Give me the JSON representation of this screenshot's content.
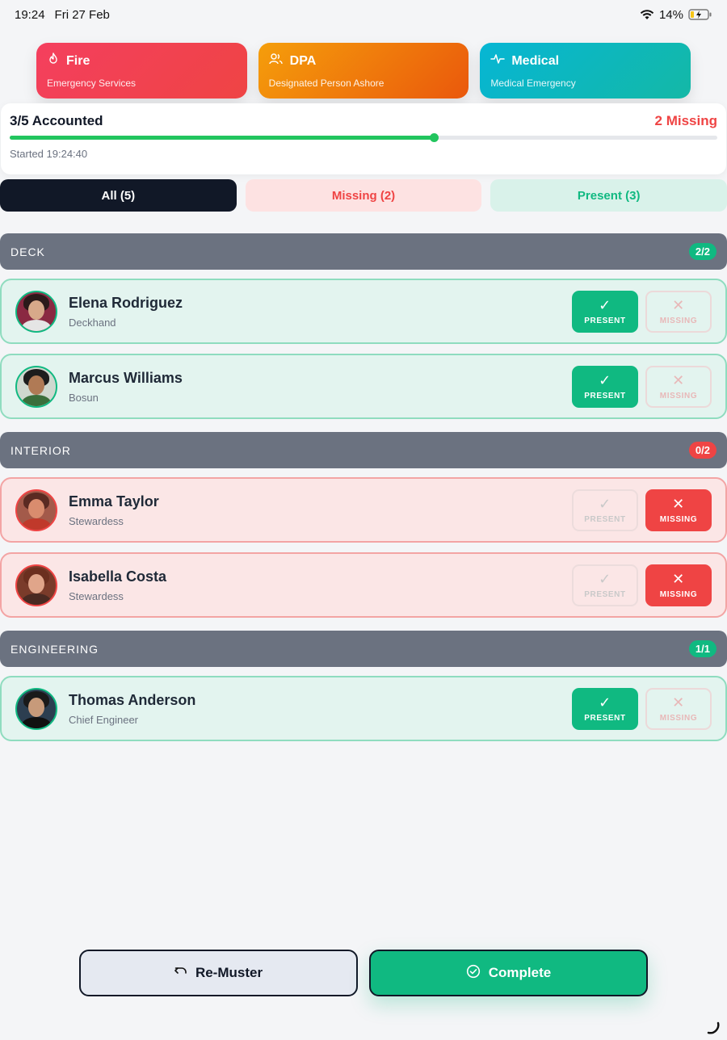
{
  "status_bar": {
    "time": "19:24",
    "date": "Fri 27 Feb",
    "battery": "14%"
  },
  "emergency_types": [
    {
      "title": "Fire",
      "subtitle": "Emergency Services",
      "icon": "flame-icon"
    },
    {
      "title": "DPA",
      "subtitle": "Designated Person Ashore",
      "icon": "users-icon"
    },
    {
      "title": "Medical",
      "subtitle": "Medical Emergency",
      "icon": "pulse-icon"
    }
  ],
  "summary": {
    "accounted": "3/5 Accounted",
    "missing": "2 Missing",
    "started": "Started 19:24:40",
    "progress_fraction": 0.6
  },
  "filters": {
    "all": "All (5)",
    "missing": "Missing (2)",
    "present": "Present (3)"
  },
  "groups": [
    {
      "name": "DECK",
      "badge": "2/2"
    },
    {
      "name": "INTERIOR",
      "badge": "0/2"
    },
    {
      "name": "ENGINEERING",
      "badge": "1/1"
    }
  ],
  "crew": [
    {
      "name": "Elena Rodriguez",
      "role": "Deckhand",
      "status": "present"
    },
    {
      "name": "Marcus Williams",
      "role": "Bosun",
      "status": "present"
    },
    {
      "name": "Emma Taylor",
      "role": "Stewardess",
      "status": "missing"
    },
    {
      "name": "Isabella Costa",
      "role": "Stewardess",
      "status": "missing"
    },
    {
      "name": "Thomas Anderson",
      "role": "Chief Engineer",
      "status": "present"
    }
  ],
  "buttons": {
    "present": "PRESENT",
    "missing": "MISSING"
  },
  "actions": {
    "remuster": "Re-Muster",
    "complete": "Complete"
  },
  "colors": {
    "present": "#10b981",
    "missing": "#ef4444",
    "dark": "#111827",
    "group": "#6b7280"
  }
}
